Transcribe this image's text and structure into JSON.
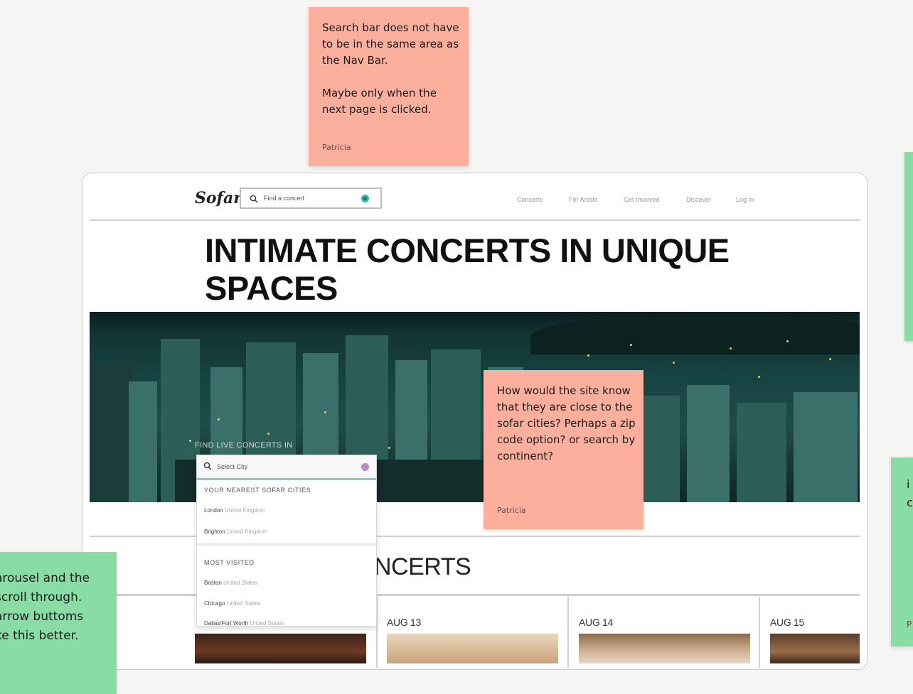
{
  "notes": {
    "top": {
      "text": "Search bar does not have to be in the same area as the Nav Bar.\n\nMaybe only when the next page is clicked.",
      "author": "Patricia"
    },
    "middle": {
      "text": "How would the site know that they are close to the sofar cities? Perhaps a zip code option? or search by continent?",
      "author": "Patricia"
    },
    "left_partial": {
      "lines": [
        "arousel and the",
        "scroll through.",
        "arrow buttoms",
        "ke this better."
      ]
    },
    "right_partial": {
      "lines": [
        "i",
        "c"
      ],
      "author_initial": "P"
    }
  },
  "site": {
    "logo": "Sofar",
    "search_placeholder": "Find a concert",
    "nav": [
      "Concerts",
      "For Artists",
      "Get Involved",
      "Discover",
      "Log In"
    ],
    "headline": "INTIMATE CONCERTS IN UNIQUE SPACES",
    "hero_label": "FIND LIVE CONCERTS IN",
    "city_search": {
      "placeholder": "Select City",
      "nearest_heading": "YOUR NEAREST SOFAR CITIES",
      "nearest": [
        {
          "city": "London",
          "country": "United Kingdom"
        },
        {
          "city": "Brighton",
          "country": "United Kingdom"
        }
      ],
      "most_visited_heading": "MOST VISITED",
      "most_visited": [
        {
          "city": "Boston",
          "country": "United States"
        },
        {
          "city": "Chicago",
          "country": "United States"
        },
        {
          "city": "Dallas/Fort Worth",
          "country": "United States"
        }
      ]
    },
    "concerts_heading_visible": "NCERTS",
    "dates": [
      "AUG 13",
      "AUG 14",
      "AUG 15"
    ]
  },
  "colors": {
    "sticky_pink": "#fcaf9d",
    "sticky_green": "#88dca4",
    "accent_teal": "#3fb6a4"
  }
}
